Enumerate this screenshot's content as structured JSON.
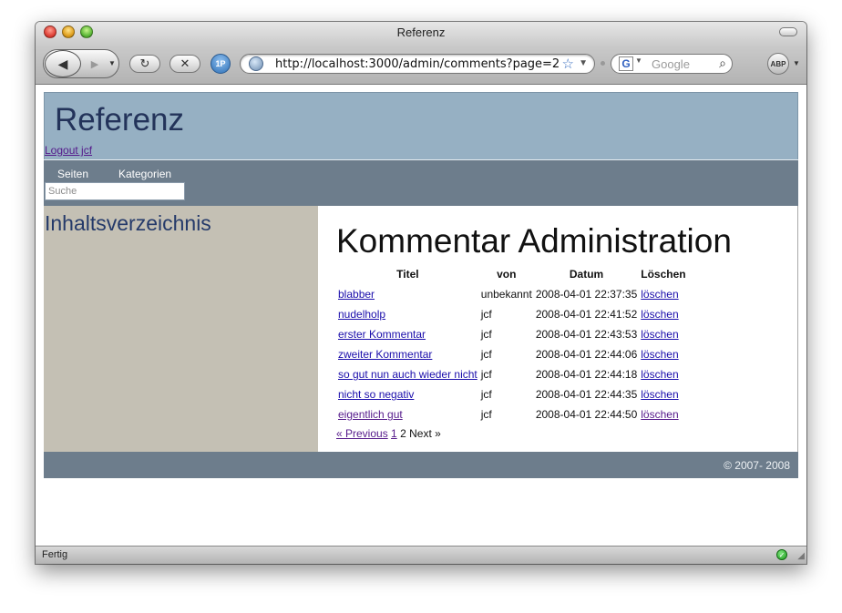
{
  "window": {
    "title": "Referenz"
  },
  "toolbar": {
    "url": "http://localhost:3000/admin/comments?page=2",
    "search_placeholder": "Google",
    "onepassword_label": "1P",
    "adblock_label": "ABP"
  },
  "site": {
    "brand": "Referenz",
    "logout_label": "Logout jcf",
    "nav": [
      {
        "label": "Seiten"
      },
      {
        "label": "Kategorien"
      }
    ],
    "search_placeholder": "Suche",
    "sidebar_title": "Inhaltsverzeichnis",
    "page_title": "Kommentar Administration",
    "table": {
      "headers": [
        "Titel",
        "von",
        "Datum",
        "Löschen"
      ],
      "rows": [
        {
          "title": "blabber",
          "author": "unbekannt",
          "date": "2008-04-01 22:37:35",
          "delete": "löschen",
          "visited": false
        },
        {
          "title": "nudelholp",
          "author": "jcf",
          "date": "2008-04-01 22:41:52",
          "delete": "löschen",
          "visited": false
        },
        {
          "title": "erster Kommentar",
          "author": "jcf",
          "date": "2008-04-01 22:43:53",
          "delete": "löschen",
          "visited": false
        },
        {
          "title": "zweiter Kommentar",
          "author": "jcf",
          "date": "2008-04-01 22:44:06",
          "delete": "löschen",
          "visited": false
        },
        {
          "title": "so gut nun auch wieder nicht",
          "author": "jcf",
          "date": "2008-04-01 22:44:18",
          "delete": "löschen",
          "visited": false
        },
        {
          "title": "nicht so negativ",
          "author": "jcf",
          "date": "2008-04-01 22:44:35",
          "delete": "löschen",
          "visited": false
        },
        {
          "title": "eigentlich gut",
          "author": "jcf",
          "date": "2008-04-01 22:44:50",
          "delete": "löschen",
          "visited": true
        }
      ]
    },
    "pagination": {
      "previous": "« Previous",
      "page1": "1",
      "current": "2",
      "next": "Next »"
    },
    "footer": "© 2007- 2008"
  },
  "status": {
    "text": "Fertig"
  }
}
